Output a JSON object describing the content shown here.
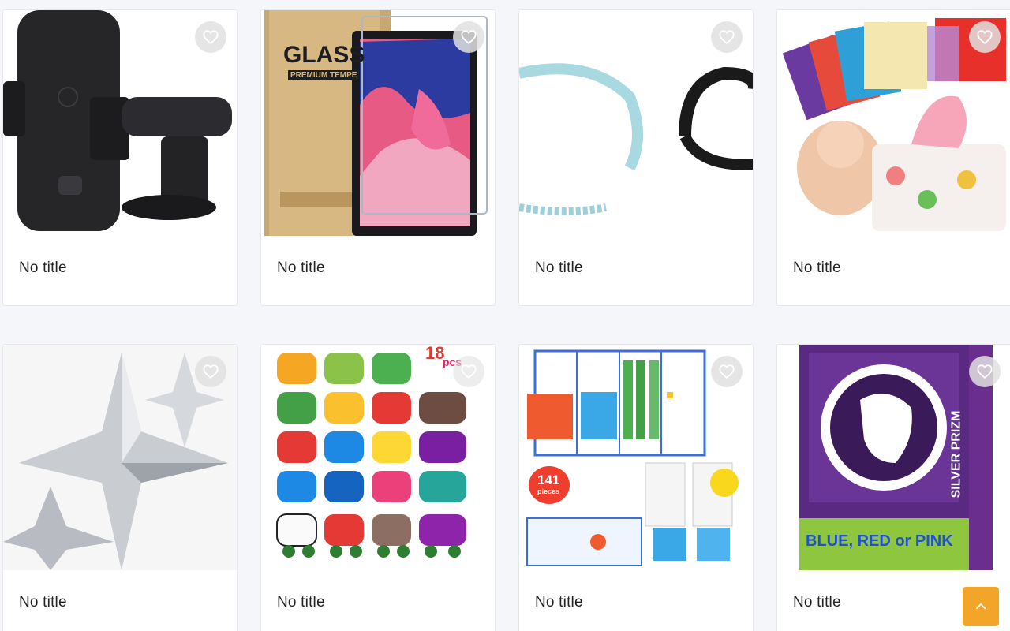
{
  "products": [
    {
      "title": "No title",
      "image": "phone-car-mount"
    },
    {
      "title": "No title",
      "image": "glass-screen-protector",
      "image_text": [
        "GLASS",
        "PREMIUM TEMPE"
      ]
    },
    {
      "title": "No title",
      "image": "headbands"
    },
    {
      "title": "No title",
      "image": "baby-tissue-box-toy"
    },
    {
      "title": "No title",
      "image": "silver-star-balloons"
    },
    {
      "title": "No title",
      "image": "toy-animal-cars",
      "image_text": [
        "18",
        "pcs"
      ]
    },
    {
      "title": "No title",
      "image": "base-ten-blocks-kit",
      "image_text": [
        "141",
        "pieces"
      ]
    },
    {
      "title": "No title",
      "image": "premier-league-prizm-cards",
      "image_text": [
        "BLUE, RED or PINK",
        "SILVER PRIZM"
      ]
    }
  ],
  "favorite_icon": "heart-outline-icon",
  "scroll_top_icon": "chevron-up-icon",
  "colors": {
    "accent": "#f3a52a",
    "background": "#f4f6f9",
    "card": "#ffffff"
  }
}
